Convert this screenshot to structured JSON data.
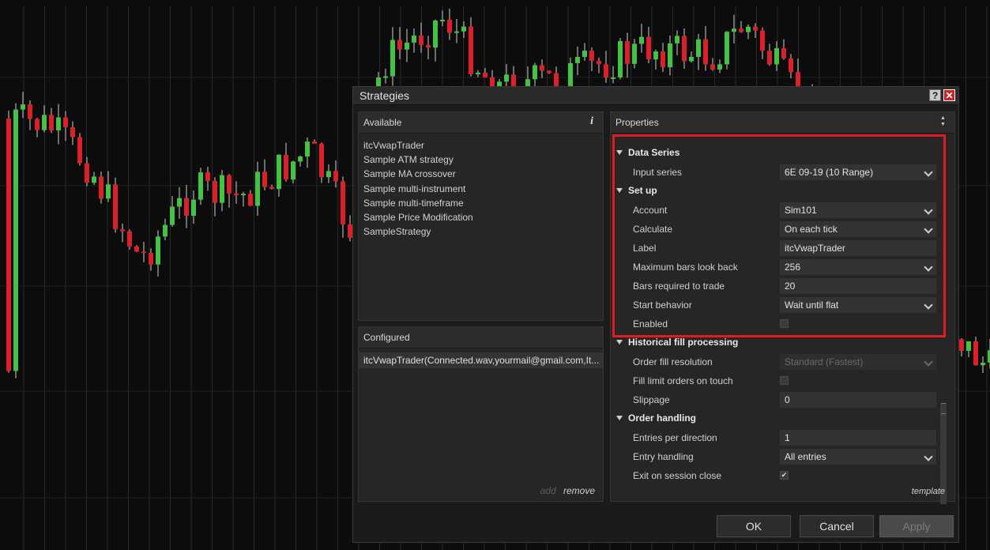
{
  "window": {
    "title": "Strategies",
    "help_label": "?",
    "close_label": "✕"
  },
  "colors": {
    "up_candle": "#44c244",
    "down_candle": "#dd1f2a",
    "highlight_border": "#e01b24"
  },
  "available": {
    "header": "Available",
    "info_icon_label": "i",
    "items": [
      "itcVwapTrader",
      "Sample ATM strategy",
      "Sample MA crossover",
      "Sample multi-instrument",
      "Sample multi-timeframe",
      "Sample Price Modification",
      "SampleStrategy"
    ]
  },
  "configured": {
    "header": "Configured",
    "items": [
      "itcVwapTrader(Connected.wav,yourmail@gmail.com,It..."
    ],
    "add_label": "add",
    "remove_label": "remove"
  },
  "properties": {
    "header": "Properties",
    "template_label": "template",
    "categories": {
      "data_series": "Data Series",
      "setup": "Set up",
      "historical": "Historical fill processing",
      "order_handling": "Order handling"
    },
    "rows": {
      "input_series": {
        "label": "Input series",
        "value": "6E 09-19 (10 Range)"
      },
      "account": {
        "label": "Account",
        "value": "Sim101"
      },
      "calculate": {
        "label": "Calculate",
        "value": "On each tick"
      },
      "label": {
        "label": "Label",
        "value": "itcVwapTrader"
      },
      "max_bars": {
        "label": "Maximum bars look back",
        "value": "256"
      },
      "bars_required": {
        "label": "Bars required to trade",
        "value": "20"
      },
      "start_behavior": {
        "label": "Start behavior",
        "value": "Wait until flat"
      },
      "enabled": {
        "label": "Enabled",
        "checked": false
      },
      "order_fill_resolution": {
        "label": "Order fill resolution",
        "value": "Standard (Fastest)"
      },
      "fill_limit": {
        "label": "Fill limit orders on touch",
        "checked": false
      },
      "slippage": {
        "label": "Slippage",
        "value": "0"
      },
      "entries_per_direction": {
        "label": "Entries per direction",
        "value": "1"
      },
      "entry_handling": {
        "label": "Entry handling",
        "value": "All entries"
      },
      "exit_on_close": {
        "label": "Exit on session close",
        "checked": true,
        "check_mark": "✔"
      }
    }
  },
  "buttons": {
    "ok": "OK",
    "cancel": "Cancel",
    "apply": "Apply"
  }
}
